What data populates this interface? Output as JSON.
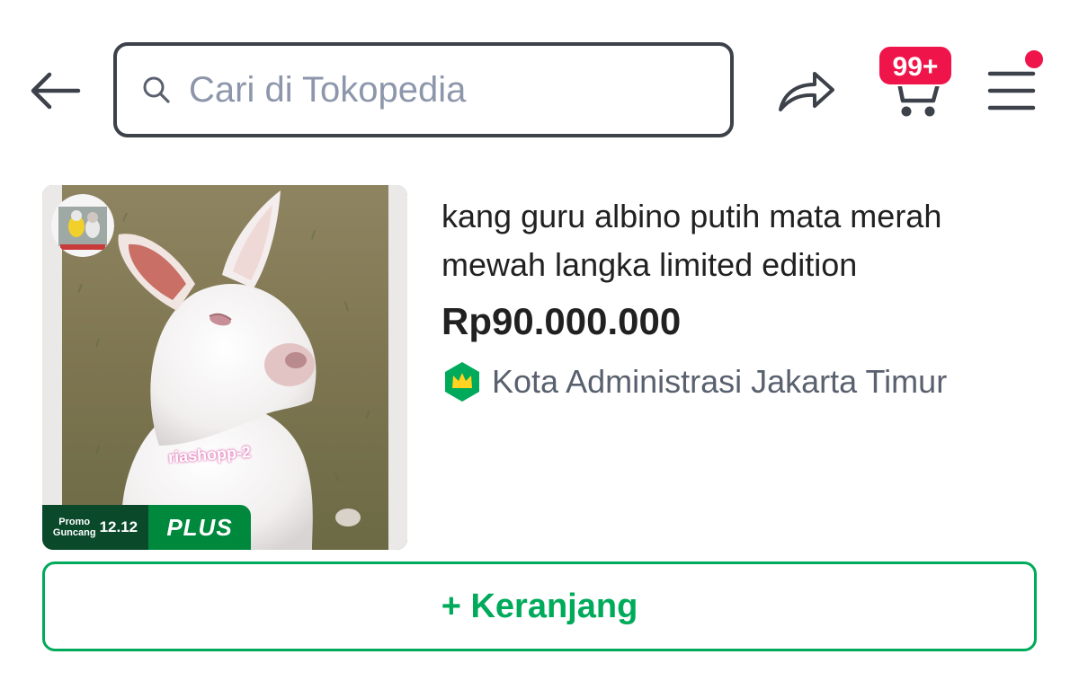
{
  "header": {
    "back_icon": "arrow-left-icon",
    "search": {
      "placeholder": "Cari di Tokopedia",
      "value": "",
      "icon": "search-icon"
    },
    "share_icon": "share-icon",
    "cart": {
      "icon": "cart-icon",
      "badge": "99+"
    },
    "menu": {
      "icon": "hamburger-menu-icon",
      "has_notification_dot": true
    }
  },
  "product": {
    "title": "kang guru albino putih mata merah mewah langka limited edition",
    "price": "Rp90.000.000",
    "location": "Kota Administrasi Jakarta Timur",
    "shop_badge_icon": "official-crown-badge-icon",
    "image": {
      "watermark": "riashopp-2",
      "promo_label": {
        "line1": "Promo",
        "line2": "Guncang",
        "number": "12.12",
        "plus": "PLUS"
      }
    }
  },
  "actions": {
    "add_to_cart": "+ Keranjang"
  },
  "colors": {
    "brand_green": "#00aa5b",
    "badge_red": "#ef144a",
    "text_primary": "#212121",
    "text_secondary": "#59606e",
    "placeholder": "#8d96aa"
  }
}
